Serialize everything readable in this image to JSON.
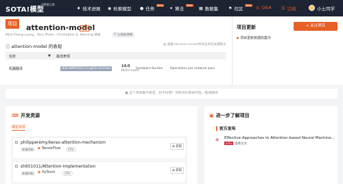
{
  "nav": {
    "logo": "SOTA!模型",
    "logo_sub": "AI数据之能",
    "items": [
      {
        "label": "技术进展",
        "icon": "trend-icon"
      },
      {
        "label": "检索模型",
        "icon": "search-icon"
      },
      {
        "label": "任务",
        "icon": "task-icon",
        "badge": "New"
      },
      {
        "label": "算法",
        "icon": "algo-icon",
        "badge": "New"
      },
      {
        "label": "数据集",
        "icon": "dataset-icon"
      },
      {
        "label": "社区",
        "icon": "community-icon",
        "badge": "New"
      },
      {
        "label": "Q&A",
        "icon": "qa-icon"
      },
      {
        "label": "订阅",
        "icon": "subscribe-icon"
      }
    ],
    "user": "小土同学"
  },
  "project": {
    "badge": "项目",
    "title": "attention-model",
    "type_tag": "模型",
    "authors": "Minh-Thang Luong、Hieu Pham、Christopher D. Manning 研发",
    "verify": "认领该项目"
  },
  "performance": {
    "title": "attention-model 的表现",
    "more": "查看attention-model所有任务的关键算法",
    "headers": {
      "task": "任务",
      "best": "最佳表现"
    },
    "rows": [
      {
        "task": "机器翻译",
        "dataset": "(EN-)WMT2014 English-German",
        "value": "14.0",
        "metric": "BLEU score",
        "hw1": "Hardware Burden",
        "hw2": "Operations per network pass"
      }
    ]
  },
  "update": {
    "title": "项目更新",
    "button": "关注项目",
    "text": "项目更新数据收集中"
  },
  "notice": "这个项目最不靠谱、好不好用？项目评价即将开放，敬请期待",
  "resources": {
    "title": "开发资源",
    "tab": "模型资源",
    "repos": [
      {
        "name": "philipperemy/keras-attention-mechanism",
        "tag": "实现代码",
        "framework": "TensorFlow",
        "device": "CPU",
        "action": "获取"
      },
      {
        "name": "sh951011/Attention-Implementation",
        "tag": "实现代码",
        "framework": "PyTorch",
        "device": "CPU",
        "action": "获取"
      }
    ]
  },
  "learn": {
    "title": "进一步了解项目",
    "section": "官方发布",
    "paper_title": "Effective Approaches to Attention-based Neural Machine...",
    "paper_badge": "arXiv",
    "paper_source": "查看论文"
  },
  "colors": {
    "accent": "#e65f25",
    "nav_bg": "#1d2434"
  }
}
